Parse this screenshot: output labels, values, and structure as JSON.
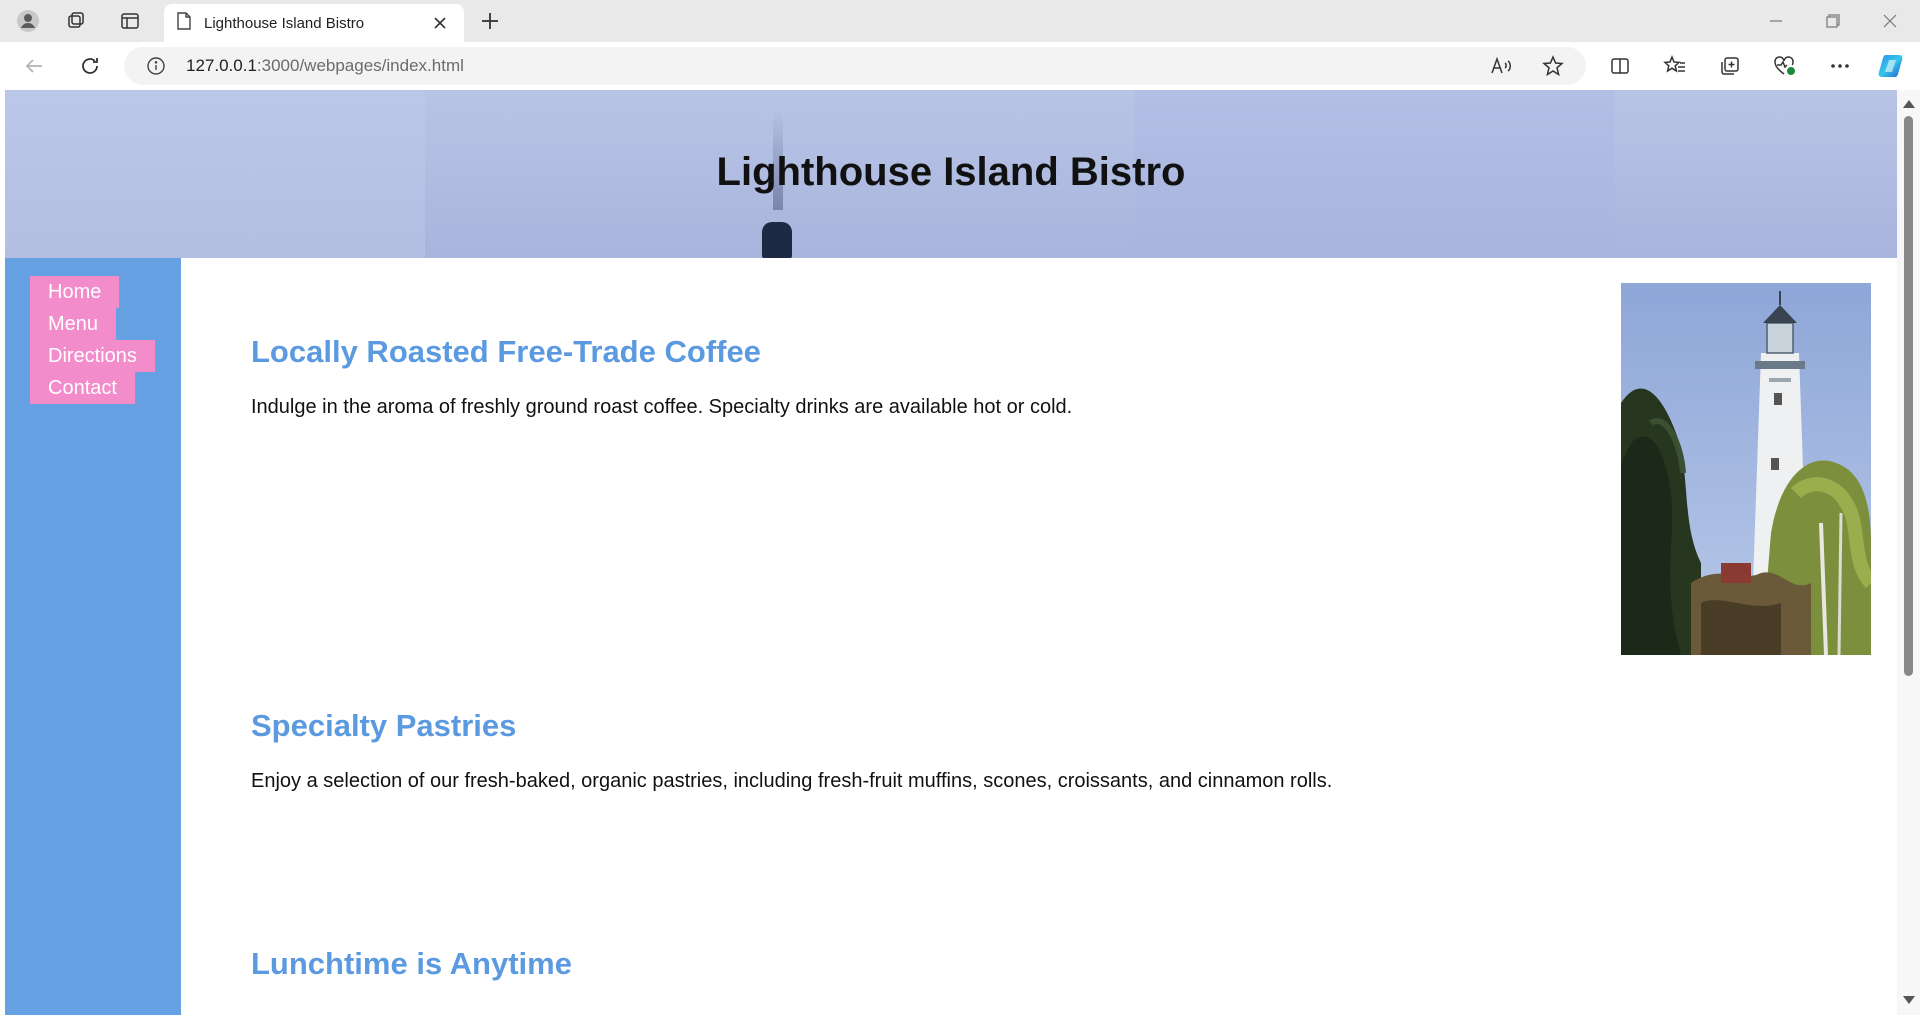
{
  "browser": {
    "tab_title": "Lighthouse Island Bistro",
    "url_host": "127.0.0.1",
    "url_rest": ":3000/webpages/index.html",
    "icons": {
      "profile": "profile-icon",
      "workspaces": "workspaces-icon",
      "tab_actions": "vertical-tabs-icon",
      "page": "page-icon",
      "close_tab": "close-icon",
      "new_tab": "plus-icon",
      "back": "back-arrow-icon",
      "refresh": "refresh-icon",
      "site_info": "info-icon",
      "read_aloud": "read-aloud-icon",
      "favorite": "star-icon",
      "split_screen": "split-screen-icon",
      "favorites": "favorites-icon",
      "collections": "collections-icon",
      "browser_essentials": "heart-pulse-icon",
      "more": "more-icon",
      "copilot": "copilot-icon"
    }
  },
  "page": {
    "site_title": "Lighthouse Island Bistro",
    "nav": [
      "Home",
      "Menu",
      "Directions",
      "Contact"
    ],
    "sections": [
      {
        "heading": "Locally Roasted Free-Trade Coffee",
        "text": "Indulge in the aroma of freshly ground roast coffee. Specialty drinks are available hot or cold."
      },
      {
        "heading": "Specialty Pastries",
        "text": "Enjoy a selection of our fresh-baked, organic pastries, including fresh-fruit muffins, scones, croissants, and cinnamon rolls."
      },
      {
        "heading": "Lunchtime is Anytime",
        "text": ""
      }
    ],
    "colors": {
      "sidebar": "#66a1e3",
      "nav_item": "#f28ccb",
      "heading": "#5b9ae0"
    }
  }
}
